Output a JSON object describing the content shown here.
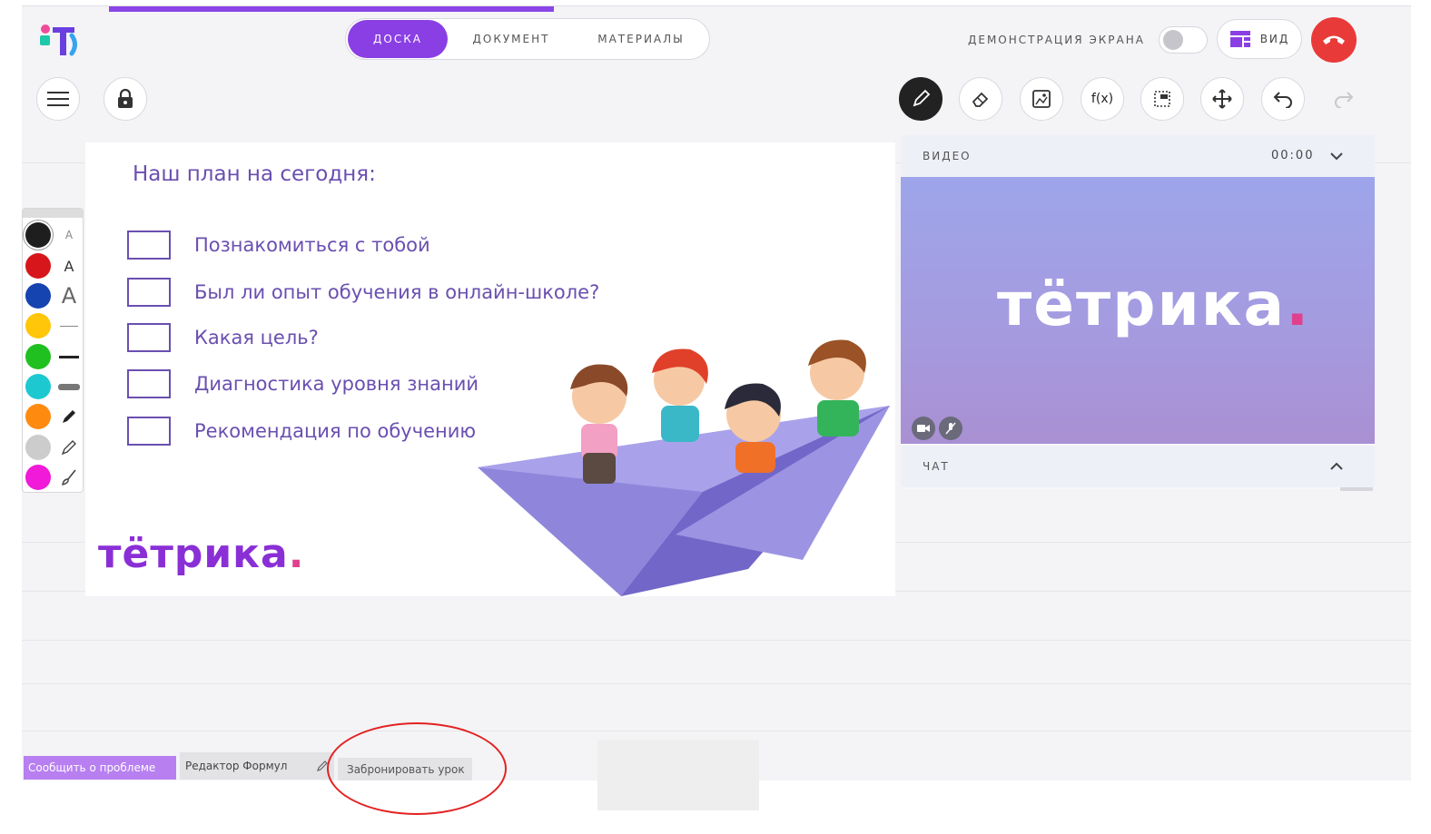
{
  "header": {
    "tabs": [
      {
        "label": "ДОСКА",
        "active": true
      },
      {
        "label": "ДОКУМЕНТ",
        "active": false
      },
      {
        "label": "МАТЕРИАЛЫ",
        "active": false
      }
    ],
    "screen_share_label": "ДЕМОНСТРАЦИЯ ЭКРАНА",
    "screen_share_on": false,
    "view_label": "ВИД"
  },
  "toolbar": {
    "left": [
      "menu-icon",
      "lock-icon"
    ],
    "right": [
      {
        "icon": "pencil-icon",
        "active": true
      },
      {
        "icon": "eraser-icon"
      },
      {
        "icon": "image-icon"
      },
      {
        "icon": "formula-icon",
        "label": "f(x)"
      },
      {
        "icon": "select-icon"
      },
      {
        "icon": "move-icon"
      },
      {
        "icon": "undo-icon"
      },
      {
        "icon": "redo-icon",
        "disabled": true
      }
    ]
  },
  "palette": {
    "colors": [
      "#1e1e1e",
      "#d6161b",
      "#1543b0",
      "#ffc60a",
      "#20c020",
      "#1ec8d0",
      "#ff8a10",
      "#cccccc",
      "#f01ad8"
    ],
    "text_sizes": [
      "A",
      "A",
      "A"
    ]
  },
  "board": {
    "title": "Наш план на сегодня:",
    "items": [
      "Познакомиться с тобой",
      "Был ли опыт обучения в онлайн-школе?",
      "Какая цель?",
      "Диагностика уровня знаний",
      "Рекомендация по обучению"
    ],
    "logo": "тётрика",
    "logo_dot": "."
  },
  "video": {
    "label": "ВИДЕО",
    "time": "00:00",
    "logo": "тётрика",
    "logo_dot": ".",
    "chat_label": "ЧАТ"
  },
  "bottom": {
    "report_label": "Сообщить о проблеме",
    "formula_label": "Редактор Формул",
    "book_label": "Забронировать урок"
  },
  "colors": {
    "accent": "#8a3fe4",
    "hangup": "#e93a3a",
    "plan_text": "#6a4fb0",
    "annotation": "#e32222"
  }
}
